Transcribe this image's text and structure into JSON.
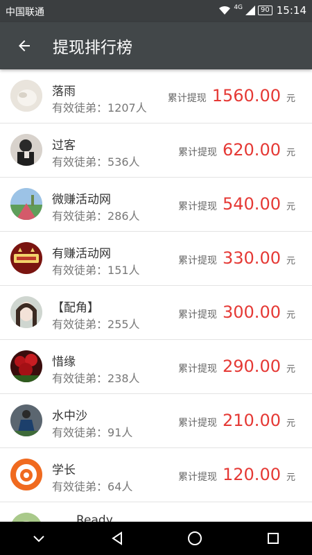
{
  "status": {
    "carrier": "中国联通",
    "network": "4G",
    "battery": "90",
    "time": "15:14"
  },
  "header": {
    "title": "提现排行榜"
  },
  "rank_list": [
    {
      "name": "落雨",
      "sub_label": "有效徒弟：",
      "sub_value": "1207人",
      "cum_label": "累计提现",
      "amount": "1560.00",
      "unit": "元"
    },
    {
      "name": "过客",
      "sub_label": "有效徒弟：",
      "sub_value": "536人",
      "cum_label": "累计提现",
      "amount": "620.00",
      "unit": "元"
    },
    {
      "name": "微赚活动网",
      "sub_label": "有效徒弟：",
      "sub_value": "286人",
      "cum_label": "累计提现",
      "amount": "540.00",
      "unit": "元"
    },
    {
      "name": "有赚活动网",
      "sub_label": "有效徒弟：",
      "sub_value": "151人",
      "cum_label": "累计提现",
      "amount": "330.00",
      "unit": "元"
    },
    {
      "name": "【配角】",
      "sub_label": "有效徒弟：",
      "sub_value": "255人",
      "cum_label": "累计提现",
      "amount": "300.00",
      "unit": "元"
    },
    {
      "name": "惜缘",
      "sub_label": "有效徒弟：",
      "sub_value": "238人",
      "cum_label": "累计提现",
      "amount": "290.00",
      "unit": "元"
    },
    {
      "name": "水中沙",
      "sub_label": "有效徒弟：",
      "sub_value": "91人",
      "cum_label": "累计提现",
      "amount": "210.00",
      "unit": "元"
    },
    {
      "name": "学长",
      "sub_label": "有效徒弟：",
      "sub_value": "64人",
      "cum_label": "累计提现",
      "amount": "120.00",
      "unit": "元"
    },
    {
      "name": "Ready",
      "sub_label": "",
      "sub_value": "",
      "cum_label": "",
      "amount": "",
      "unit": ""
    }
  ],
  "colors": {
    "accent_amount": "#e53935",
    "app_bar": "#424749",
    "status_bar": "#3b3e40"
  },
  "icons": {
    "back": "arrow-left-icon",
    "nav_down": "chevron-down-icon",
    "nav_back": "triangle-back-icon",
    "nav_home": "circle-home-icon",
    "nav_recent": "square-recent-icon"
  }
}
